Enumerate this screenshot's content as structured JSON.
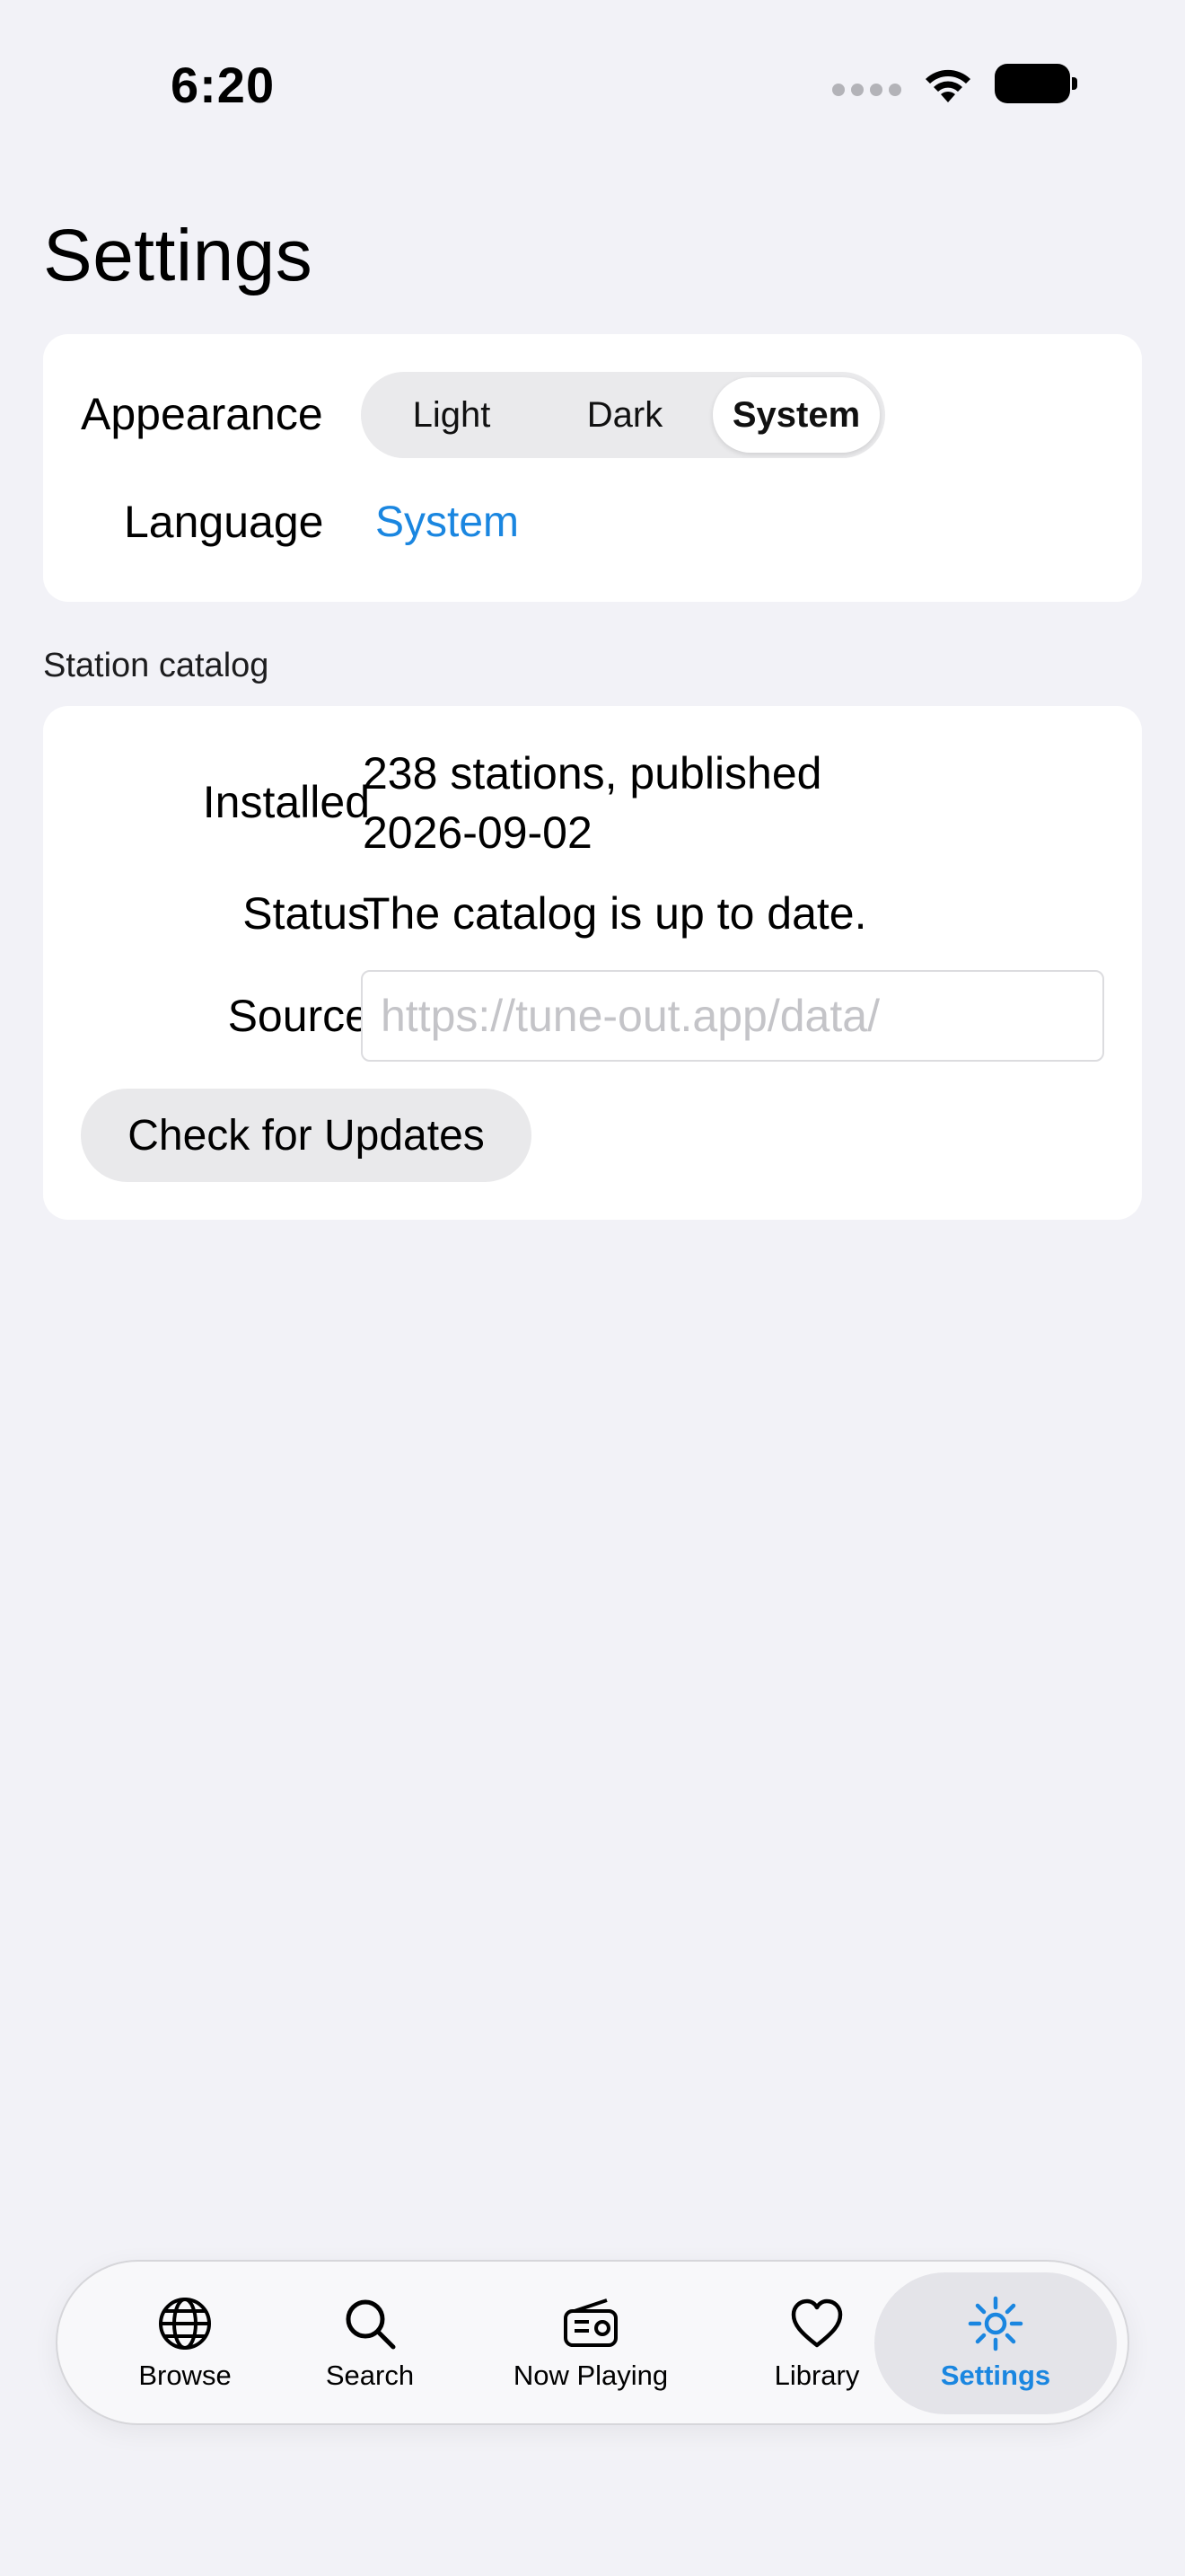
{
  "status_bar": {
    "time": "6:20"
  },
  "page": {
    "title": "Settings"
  },
  "general": {
    "appearance_label": "Appearance",
    "appearance_options": [
      "Light",
      "Dark",
      "System"
    ],
    "appearance_selected": "System",
    "language_label": "Language",
    "language_value": "System"
  },
  "catalog": {
    "section_title": "Station catalog",
    "installed_label": "Installed",
    "installed_value_line1": "238 stations, published",
    "installed_value_line2": "2026-09-02",
    "status_label": "Status",
    "status_value": "The catalog is up to date.",
    "source_label": "Source",
    "source_value": "",
    "source_placeholder": "https://tune-out.app/data/",
    "update_button": "Check for Updates"
  },
  "tabbar": {
    "items": [
      {
        "label": "Browse",
        "icon": "globe-icon"
      },
      {
        "label": "Search",
        "icon": "magnifying-glass-icon"
      },
      {
        "label": "Now Playing",
        "icon": "radio-icon"
      },
      {
        "label": "Library",
        "icon": "heart-icon"
      },
      {
        "label": "Settings",
        "icon": "gear-icon"
      }
    ],
    "selected": "Settings"
  },
  "colors": {
    "background": "#f2f2f7",
    "card": "#ffffff",
    "accent": "#1a86e0"
  }
}
